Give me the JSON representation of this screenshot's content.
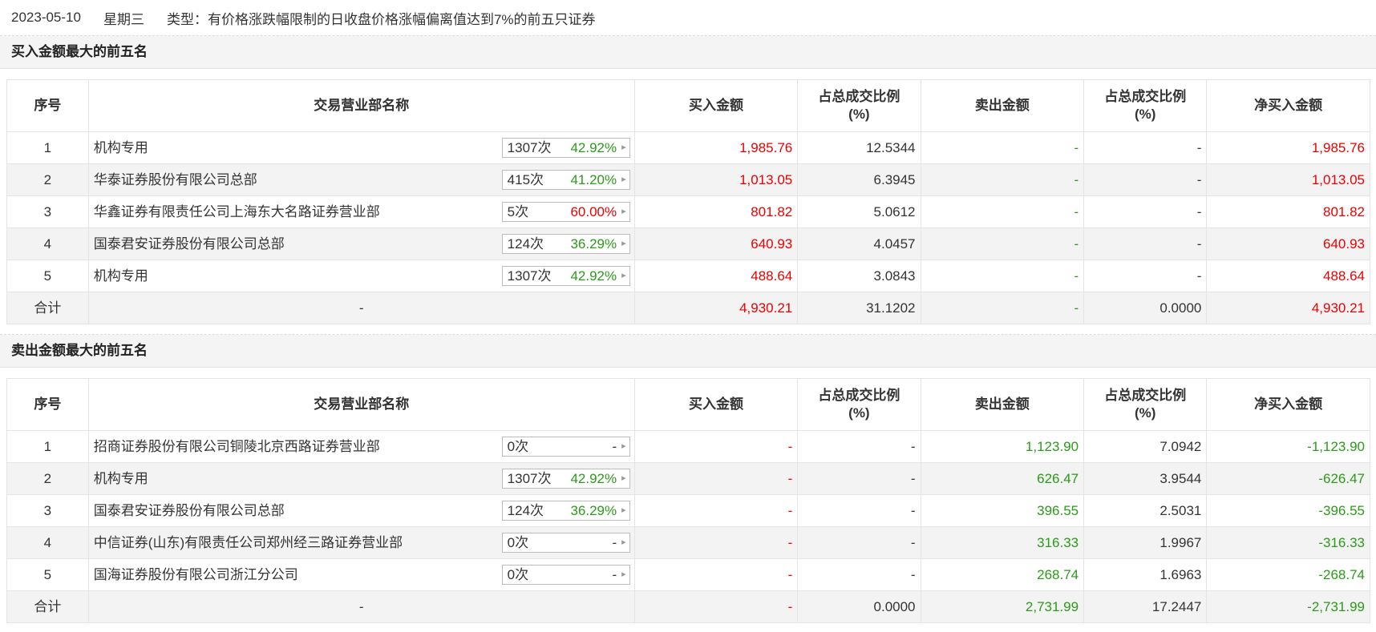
{
  "header": {
    "date": "2023-05-10",
    "weekday": "星期三",
    "type_label": "类型：有价格涨跌幅限制的日收盘价格涨幅偏离值达到7%的前五只证券"
  },
  "colors": {
    "up": "#ee0000",
    "down": "#2c9a1a"
  },
  "columns": {
    "seq": "序号",
    "name": "交易营业部名称",
    "buy": "买入金额",
    "buy_ratio": "占总成交比例\n(%)",
    "sell": "卖出金额",
    "sell_ratio": "占总成交比例\n(%)",
    "net": "净买入金额"
  },
  "buy_section": {
    "title": "买入金额最大的前五名",
    "rows": [
      {
        "seq": "1",
        "name": "机构专用",
        "times": "1307次",
        "rate": "42.92%",
        "rate_color": "green",
        "buy": "1,985.76",
        "buy_ratio": "12.5344",
        "sell": "-",
        "sell_ratio": "-",
        "net": "1,985.76",
        "net_color": "red"
      },
      {
        "seq": "2",
        "name": "华泰证券股份有限公司总部",
        "times": "415次",
        "rate": "41.20%",
        "rate_color": "green",
        "buy": "1,013.05",
        "buy_ratio": "6.3945",
        "sell": "-",
        "sell_ratio": "-",
        "net": "1,013.05",
        "net_color": "red"
      },
      {
        "seq": "3",
        "name": "华鑫证券有限责任公司上海东大名路证券营业部",
        "times": "5次",
        "rate": "60.00%",
        "rate_color": "red",
        "buy": "801.82",
        "buy_ratio": "5.0612",
        "sell": "-",
        "sell_ratio": "-",
        "net": "801.82",
        "net_color": "red"
      },
      {
        "seq": "4",
        "name": "国泰君安证券股份有限公司总部",
        "times": "124次",
        "rate": "36.29%",
        "rate_color": "green",
        "buy": "640.93",
        "buy_ratio": "4.0457",
        "sell": "-",
        "sell_ratio": "-",
        "net": "640.93",
        "net_color": "red"
      },
      {
        "seq": "5",
        "name": "机构专用",
        "times": "1307次",
        "rate": "42.92%",
        "rate_color": "green",
        "buy": "488.64",
        "buy_ratio": "3.0843",
        "sell": "-",
        "sell_ratio": "-",
        "net": "488.64",
        "net_color": "red"
      }
    ],
    "total": {
      "seq": "合计",
      "name": "-",
      "buy": "4,930.21",
      "buy_ratio": "31.1202",
      "sell": "-",
      "sell_ratio": "0.0000",
      "net": "4,930.21",
      "net_color": "red"
    }
  },
  "sell_section": {
    "title": "卖出金额最大的前五名",
    "rows": [
      {
        "seq": "1",
        "name": "招商证券股份有限公司铜陵北京西路证券营业部",
        "times": "0次",
        "rate": "-",
        "rate_color": "dark",
        "buy": "-",
        "buy_ratio": "-",
        "sell": "1,123.90",
        "sell_ratio": "7.0942",
        "net": "-1,123.90",
        "net_color": "green"
      },
      {
        "seq": "2",
        "name": "机构专用",
        "times": "1307次",
        "rate": "42.92%",
        "rate_color": "green",
        "buy": "-",
        "buy_ratio": "-",
        "sell": "626.47",
        "sell_ratio": "3.9544",
        "net": "-626.47",
        "net_color": "green"
      },
      {
        "seq": "3",
        "name": "国泰君安证券股份有限公司总部",
        "times": "124次",
        "rate": "36.29%",
        "rate_color": "green",
        "buy": "-",
        "buy_ratio": "-",
        "sell": "396.55",
        "sell_ratio": "2.5031",
        "net": "-396.55",
        "net_color": "green"
      },
      {
        "seq": "4",
        "name": "中信证券(山东)有限责任公司郑州经三路证券营业部",
        "times": "0次",
        "rate": "-",
        "rate_color": "dark",
        "buy": "-",
        "buy_ratio": "-",
        "sell": "316.33",
        "sell_ratio": "1.9967",
        "net": "-316.33",
        "net_color": "green"
      },
      {
        "seq": "5",
        "name": "国海证券股份有限公司浙江分公司",
        "times": "0次",
        "rate": "-",
        "rate_color": "dark",
        "buy": "-",
        "buy_ratio": "-",
        "sell": "268.74",
        "sell_ratio": "1.6963",
        "net": "-268.74",
        "net_color": "green"
      }
    ],
    "total": {
      "seq": "合计",
      "name": "-",
      "buy": "-",
      "buy_ratio": "0.0000",
      "sell": "2,731.99",
      "sell_ratio": "17.2447",
      "net": "-2,731.99",
      "net_color": "green"
    }
  }
}
